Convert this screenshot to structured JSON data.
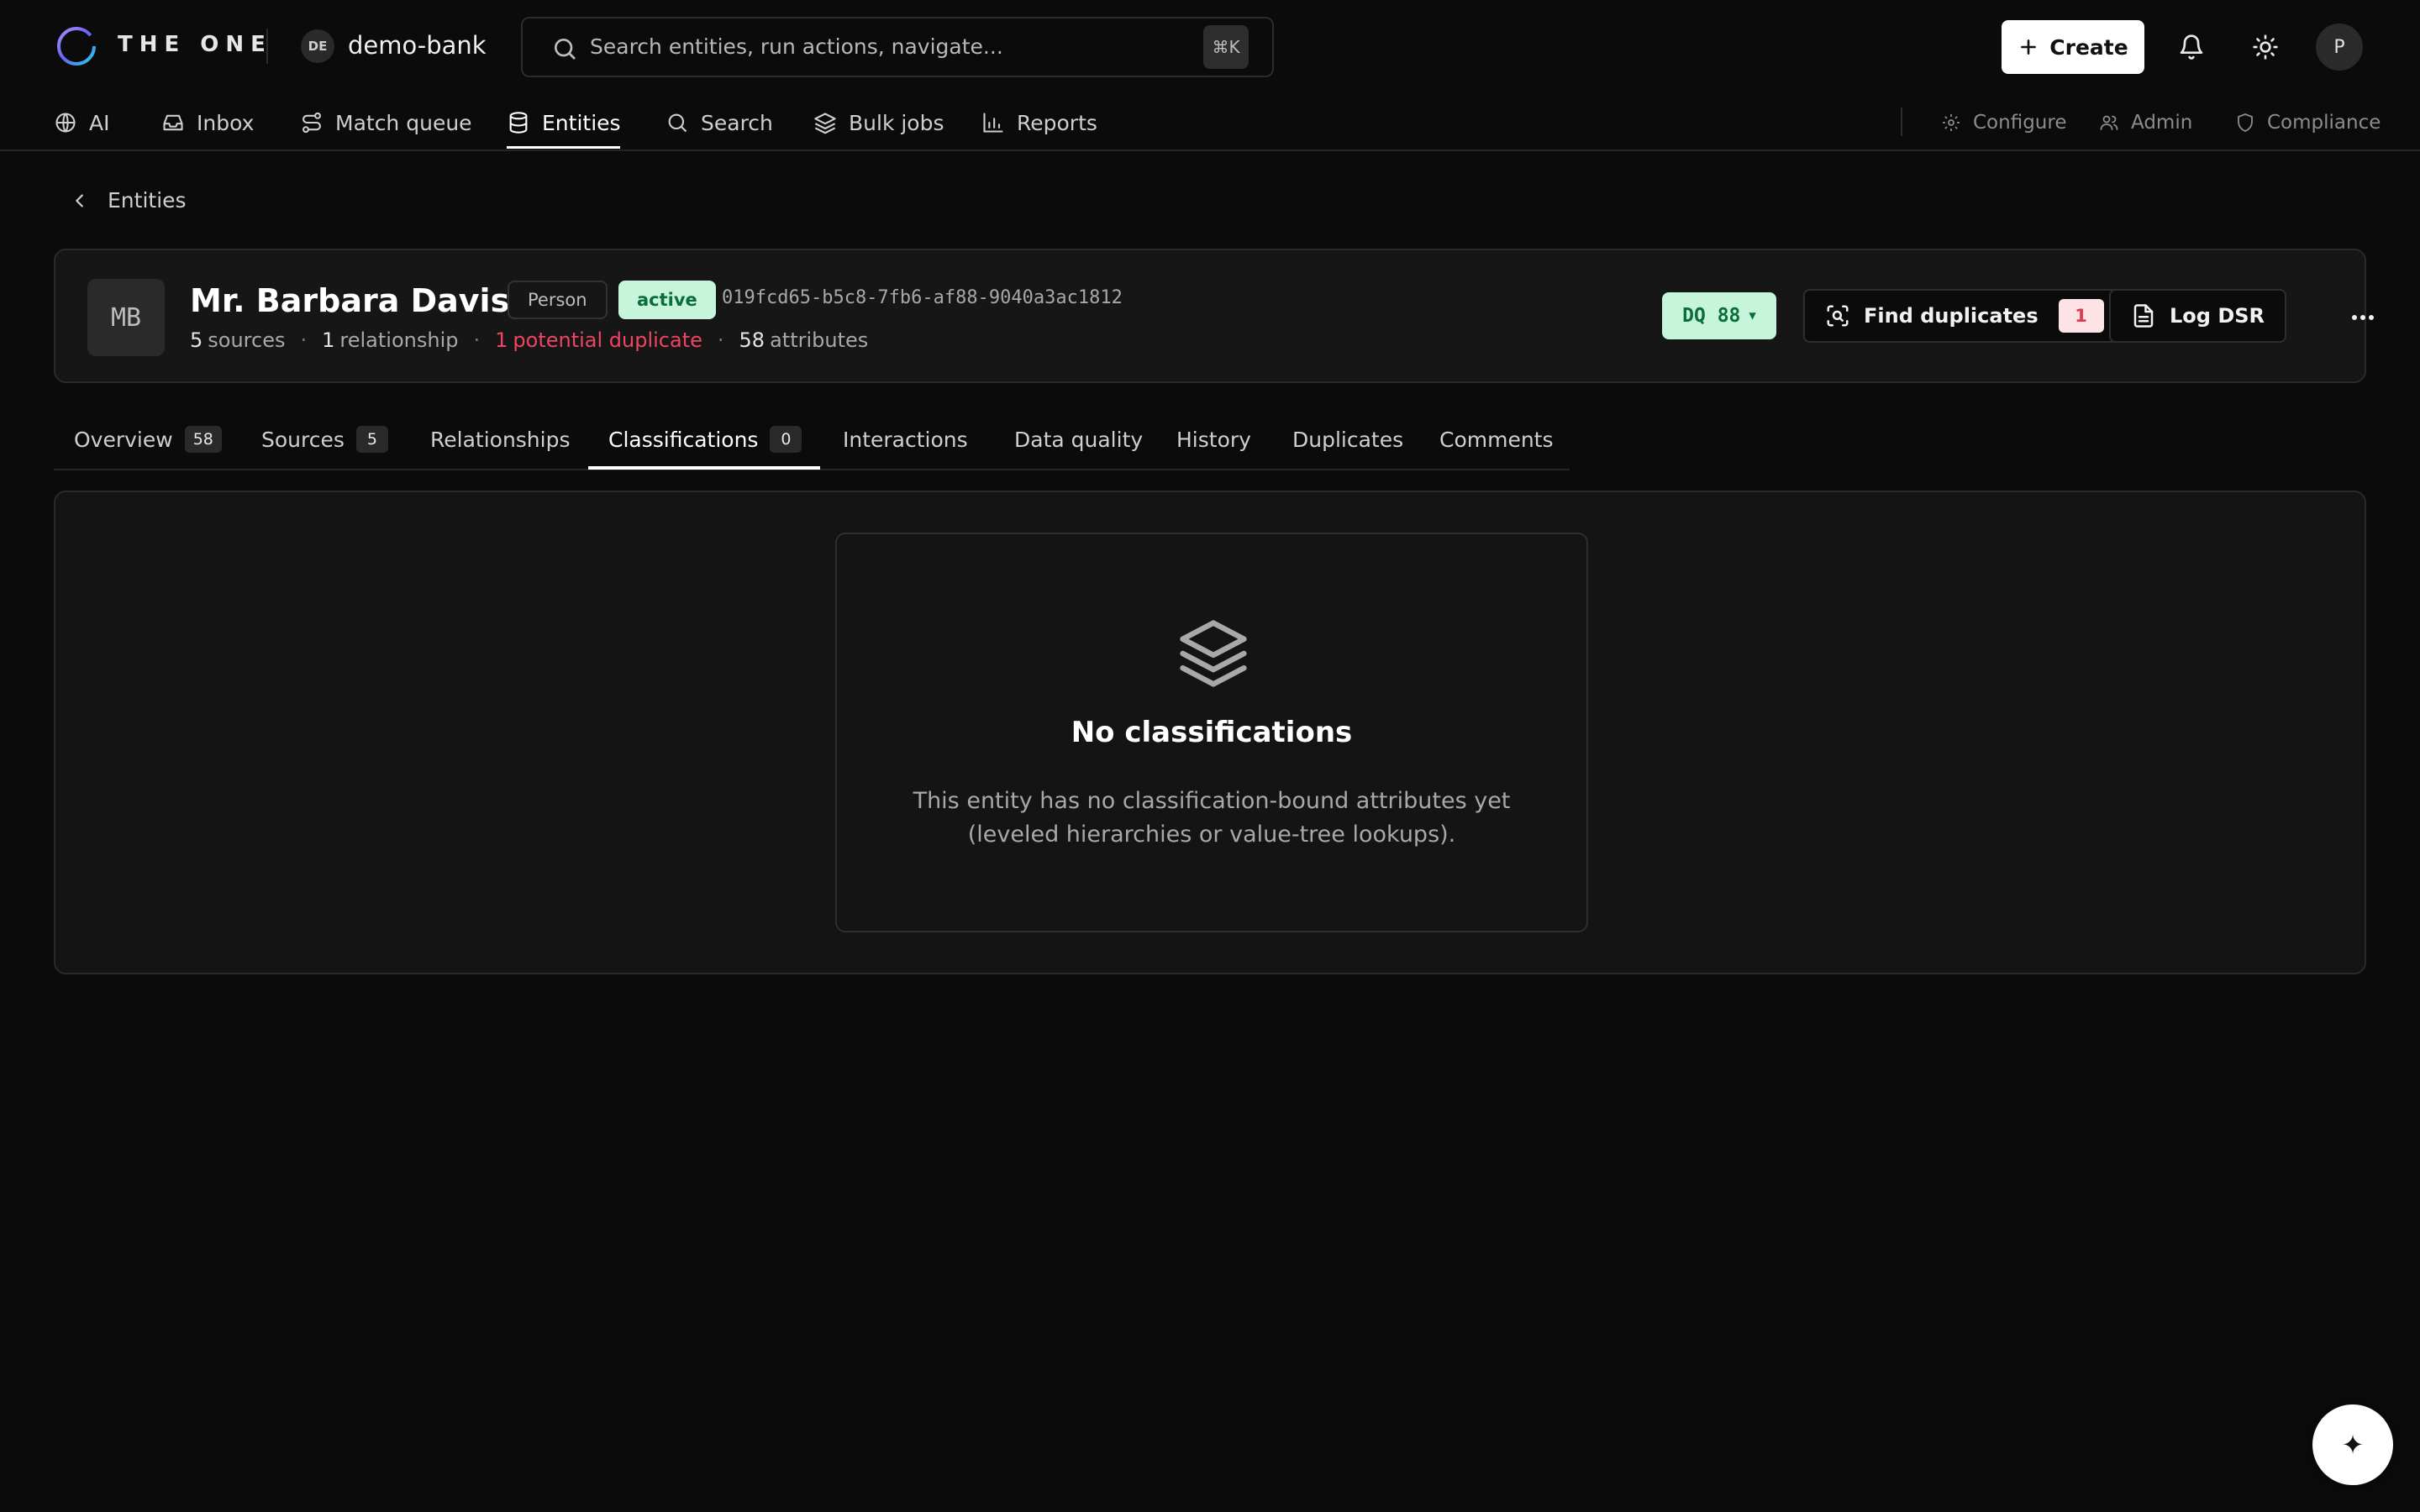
{
  "app": {
    "brand": "THE ONE",
    "workspace_badge": "DE",
    "workspace_name": "demo-bank"
  },
  "search": {
    "placeholder": "Search entities, run actions, navigate...",
    "shortcut": "⌘K"
  },
  "topbar": {
    "create_label": "Create",
    "user_initial": "P"
  },
  "nav": {
    "items": [
      {
        "label": "AI",
        "icon": "globe-icon"
      },
      {
        "label": "Inbox",
        "icon": "inbox-icon"
      },
      {
        "label": "Match queue",
        "icon": "route-icon"
      },
      {
        "label": "Entities",
        "icon": "database-icon",
        "active": true
      },
      {
        "label": "Search",
        "icon": "search-icon"
      },
      {
        "label": "Bulk jobs",
        "icon": "layers-icon"
      },
      {
        "label": "Reports",
        "icon": "bar-chart-icon"
      }
    ],
    "secondary": [
      {
        "label": "Configure",
        "icon": "gear-icon"
      },
      {
        "label": "Admin",
        "icon": "users-icon"
      },
      {
        "label": "Compliance",
        "icon": "shield-icon"
      }
    ]
  },
  "breadcrumb": {
    "back_label": "Entities"
  },
  "entity": {
    "initials": "MB",
    "name": "Mr. Barbara Davis",
    "type": "Person",
    "status": "active",
    "id": "019fcd65-b5c8-7fb6-af88-9040a3ac1812",
    "meta": {
      "sources_count": "5",
      "sources_label": "sources",
      "relationships_count": "1",
      "relationships_label": "relationship",
      "duplicates_count": "1",
      "duplicates_label": "potential duplicate",
      "attributes_count": "58",
      "attributes_label": "attributes"
    },
    "dq_label": "DQ 88",
    "actions": {
      "find_duplicates": "Find duplicates",
      "duplicates_badge": "1",
      "log_dsr": "Log DSR"
    }
  },
  "tabs": [
    {
      "label": "Overview",
      "count": "58"
    },
    {
      "label": "Sources",
      "count": "5"
    },
    {
      "label": "Relationships"
    },
    {
      "label": "Classifications",
      "count": "0",
      "active": true
    },
    {
      "label": "Interactions"
    },
    {
      "label": "Data quality"
    },
    {
      "label": "History"
    },
    {
      "label": "Duplicates"
    },
    {
      "label": "Comments"
    }
  ],
  "empty_state": {
    "icon": "layers-icon",
    "title": "No classifications",
    "description": "This entity has no classification-bound attributes yet (leveled hierarchies or value-tree lookups)."
  },
  "fab": {
    "icon": "sparkle-icon"
  },
  "colors": {
    "background": "#0b0b0b",
    "success_bg": "#c7f5dc",
    "success_fg": "#0b6e3a",
    "danger": "#f04461"
  }
}
